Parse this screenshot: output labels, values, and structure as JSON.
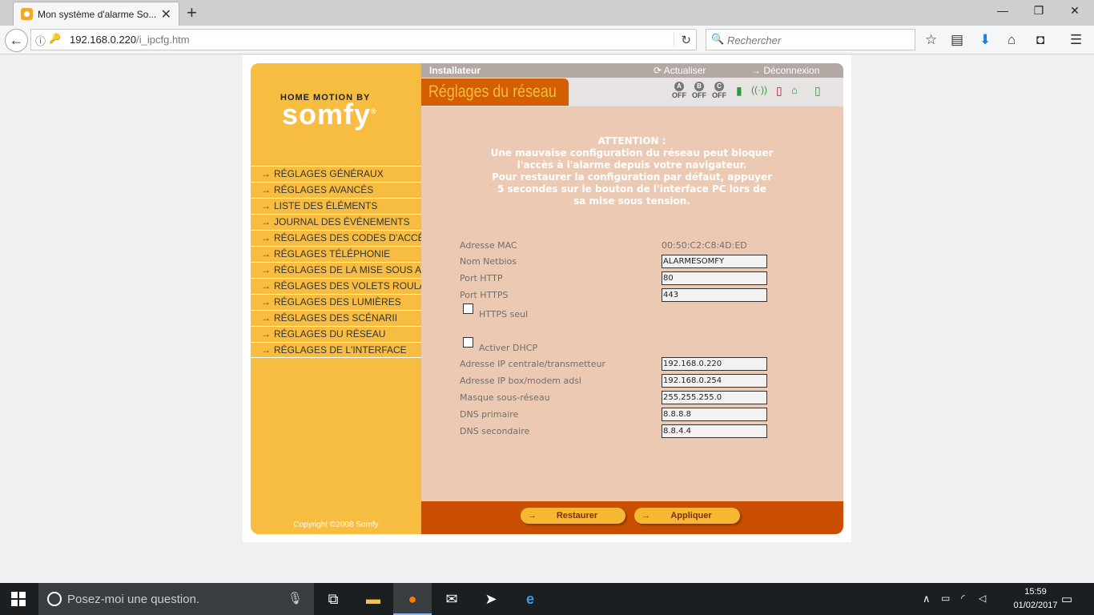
{
  "browser": {
    "tab_title": "Mon système d'alarme So...",
    "tab_close": "✕",
    "new_tab": "+",
    "window": {
      "minimize": "—",
      "restore": "❐",
      "close": "✕"
    },
    "url_host": "192.168.0.220",
    "url_path": "/i_ipcfg.htm",
    "search_placeholder": "Rechercher"
  },
  "app": {
    "brand_top": "HOME MOTION BY",
    "brand_main": "somfy",
    "copyright": "Copyright ©2008 Somfy",
    "menu": [
      "RÉGLAGES GÉNÉRAUX",
      "RÉGLAGES AVANCÉS",
      "LISTE DES ÉLÉMENTS",
      "JOURNAL DES ÉVÉNEMENTS",
      "RÉGLAGES DES CODES D'ACCÈS",
      "RÉGLAGES TÉLÉPHONIE",
      "RÉGLAGES DE LA MISE SOUS ALARME",
      "RÉGLAGES DES VOLETS ROULANTS",
      "RÉGLAGES DES LUMIÈRES",
      "RÉGLAGES DES SCÉNARII",
      "RÉGLAGES DU RÉSEAU",
      "RÉGLAGES DE L'INTERFACE"
    ],
    "top": {
      "role": "Installateur",
      "refresh": "Actualiser",
      "logout": "Déconnexion"
    },
    "page_title": "Réglages du réseau",
    "zones": [
      {
        "letter": "A",
        "state": "OFF"
      },
      {
        "letter": "B",
        "state": "OFF"
      },
      {
        "letter": "C",
        "state": "OFF"
      }
    ],
    "attention": [
      "ATTENTION :",
      "Une mauvaise configuration du réseau peut bloquer",
      "l'accès à l'alarme depuis votre navigateur.",
      "Pour restaurer la configuration par défaut, appuyer",
      "5 secondes sur le bouton de l'interface PC lors de",
      "sa mise sous tension."
    ],
    "fields": {
      "mac_label": "Adresse MAC",
      "mac_value": "00:50:C2:C8:4D:ED",
      "netbios_label": "Nom Netbios",
      "netbios_value": "ALARMESOMFY",
      "http_label": "Port HTTP",
      "http_value": "80",
      "https_label": "Port HTTPS",
      "https_value": "443",
      "https_only_label": "HTTPS seul",
      "dhcp_label": "Activer DHCP",
      "ip_label": "Adresse IP centrale/transmetteur",
      "ip_value": "192.168.0.220",
      "gw_label": "Adresse IP box/modem adsl",
      "gw_value": "192.168.0.254",
      "mask_label": "Masque sous-réseau",
      "mask_value": "255.255.255.0",
      "dns1_label": "DNS primaire",
      "dns1_value": "8.8.8.8",
      "dns2_label": "DNS secondaire",
      "dns2_value": "8.8.4.4"
    },
    "buttons": {
      "restore": "Restaurer",
      "apply": "Appliquer"
    }
  },
  "taskbar": {
    "search_text": "Posez-moi une question.",
    "time": "15:59",
    "date": "01/02/2017"
  }
}
